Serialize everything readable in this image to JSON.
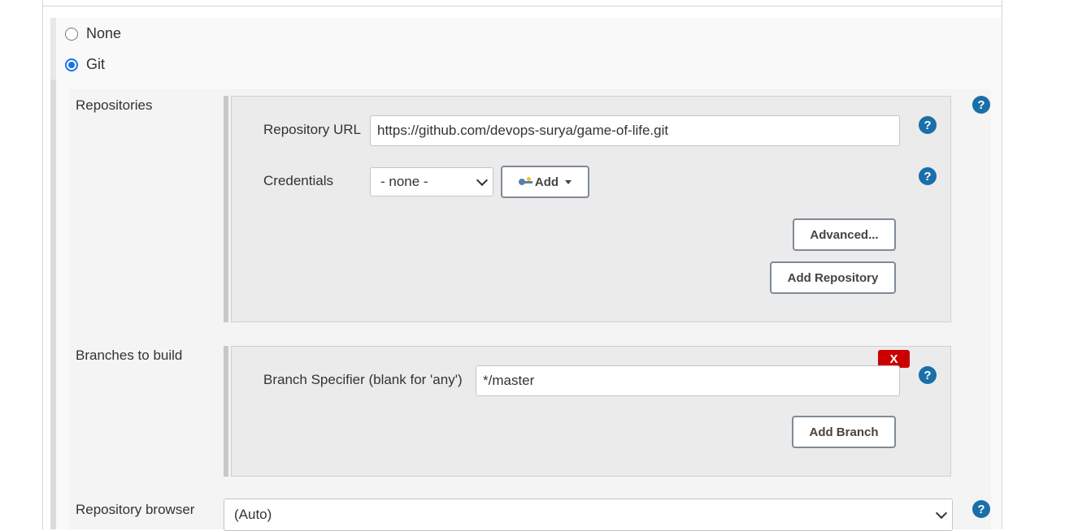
{
  "scm": {
    "options": [
      {
        "label": "None",
        "checked": false
      },
      {
        "label": "Git",
        "checked": true
      }
    ]
  },
  "repositories": {
    "section_label": "Repositories",
    "repository_url_label": "Repository URL",
    "repository_url_value": "https://github.com/devops-surya/game-of-life.git",
    "credentials_label": "Credentials",
    "credentials_selected": "- none -",
    "add_credentials_label": "Add",
    "advanced_label": "Advanced...",
    "add_repository_label": "Add Repository"
  },
  "branches": {
    "section_label": "Branches to build",
    "delete_label": "X",
    "branch_specifier_label": "Branch Specifier (blank for 'any')",
    "branch_specifier_value": "*/master",
    "add_branch_label": "Add Branch"
  },
  "repository_browser": {
    "label": "Repository browser",
    "selected": "(Auto)"
  },
  "help_label": "?",
  "colors": {
    "help_icon": "#1a6fa8",
    "delete_button": "#cc0000",
    "radio_checked": "#1a73e8"
  }
}
